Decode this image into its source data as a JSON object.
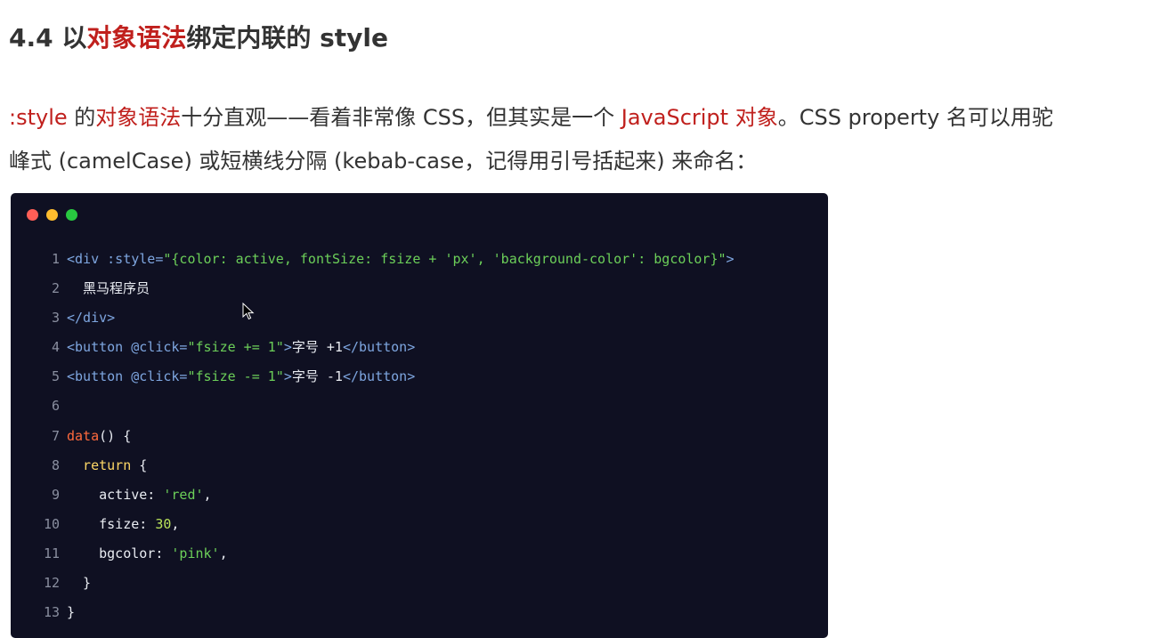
{
  "heading": {
    "prefix": "4.4 以",
    "highlight": "对象语法",
    "suffix": "绑定内联的 style"
  },
  "paragraph": {
    "line1": [
      {
        "text": ":style",
        "red": true
      },
      {
        "text": " 的",
        "red": false
      },
      {
        "text": "对象语法",
        "red": true
      },
      {
        "text": "十分直观——看着非常像 CSS，但其实是一个 ",
        "red": false
      },
      {
        "text": "JavaScript 对象",
        "red": true
      },
      {
        "text": "。CSS property 名可以用驼",
        "red": false
      }
    ],
    "line2": "峰式 (camelCase) 或短横线分隔 (kebab-case，记得用引号括起来) 来命名："
  },
  "code_window": {
    "dot_colors": [
      "#ff5f57",
      "#febc2e",
      "#28c840"
    ],
    "lines": [
      {
        "n": "1",
        "tokens": [
          {
            "t": "<div",
            "c": "tag"
          },
          {
            "t": " :style=",
            "c": "attr"
          },
          {
            "t": "\"{color: active, fontSize: fsize + 'px', 'background-color': bgcolor}\"",
            "c": "str"
          },
          {
            "t": ">",
            "c": "tag"
          }
        ]
      },
      {
        "n": "2",
        "tokens": [
          {
            "t": "  黑马程序员",
            "c": "plain"
          }
        ]
      },
      {
        "n": "3",
        "tokens": [
          {
            "t": "</div>",
            "c": "tag"
          }
        ]
      },
      {
        "n": "4",
        "tokens": [
          {
            "t": "<button",
            "c": "tag"
          },
          {
            "t": " @click=",
            "c": "attr"
          },
          {
            "t": "\"fsize += 1\"",
            "c": "str"
          },
          {
            "t": ">",
            "c": "tag"
          },
          {
            "t": "字号 +1",
            "c": "plain"
          },
          {
            "t": "</button>",
            "c": "tag"
          }
        ]
      },
      {
        "n": "5",
        "tokens": [
          {
            "t": "<button",
            "c": "tag"
          },
          {
            "t": " @click=",
            "c": "attr"
          },
          {
            "t": "\"fsize -= 1\"",
            "c": "str"
          },
          {
            "t": ">",
            "c": "tag"
          },
          {
            "t": "字号 -1",
            "c": "plain"
          },
          {
            "t": "</button>",
            "c": "tag"
          }
        ]
      },
      {
        "n": "6",
        "tokens": []
      },
      {
        "n": "7",
        "tokens": [
          {
            "t": "data",
            "c": "fn"
          },
          {
            "t": "() {",
            "c": "plain"
          }
        ]
      },
      {
        "n": "8",
        "tokens": [
          {
            "t": "  return",
            "c": "kw"
          },
          {
            "t": " {",
            "c": "plain"
          }
        ]
      },
      {
        "n": "9",
        "tokens": [
          {
            "t": "    active: ",
            "c": "plain"
          },
          {
            "t": "'red'",
            "c": "str"
          },
          {
            "t": ",",
            "c": "plain"
          }
        ]
      },
      {
        "n": "10",
        "tokens": [
          {
            "t": "    fsize: ",
            "c": "plain"
          },
          {
            "t": "30",
            "c": "num"
          },
          {
            "t": ",",
            "c": "plain"
          }
        ]
      },
      {
        "n": "11",
        "tokens": [
          {
            "t": "    bgcolor: ",
            "c": "plain"
          },
          {
            "t": "'pink'",
            "c": "str"
          },
          {
            "t": ",",
            "c": "plain"
          }
        ]
      },
      {
        "n": "12",
        "tokens": [
          {
            "t": "  }",
            "c": "plain"
          }
        ]
      },
      {
        "n": "13",
        "tokens": [
          {
            "t": "}",
            "c": "plain"
          }
        ]
      }
    ]
  }
}
